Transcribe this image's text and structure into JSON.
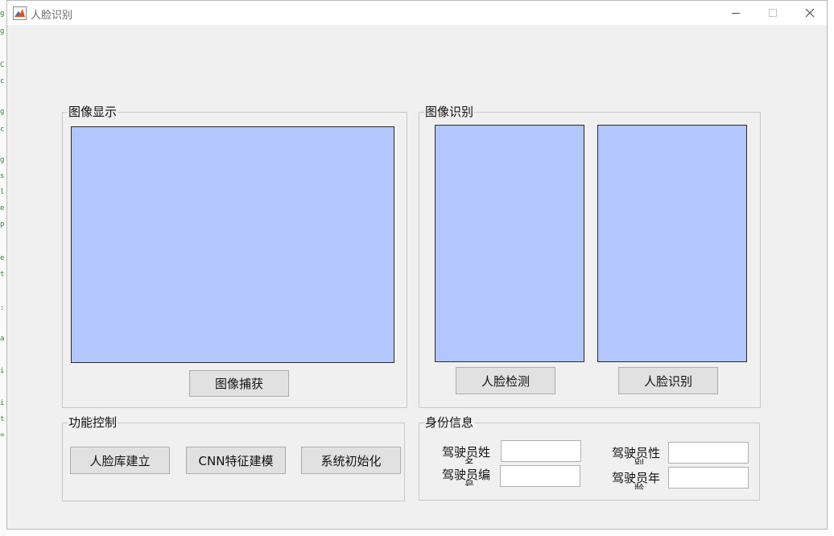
{
  "window": {
    "title": "人脸识别"
  },
  "panels": {
    "image_display": {
      "title": "图像显示",
      "capture_button": "图像捕获"
    },
    "image_recognition": {
      "title": "图像识别",
      "detect_button": "人脸检测",
      "recognize_button": "人脸识别"
    },
    "function_control": {
      "title": "功能控制",
      "buttons": [
        "人脸库建立",
        "CNN特征建模",
        "系统初始化"
      ]
    },
    "identity_info": {
      "title": "身份信息",
      "fields": [
        {
          "label": "驾驶员姓",
          "wrap": "名",
          "value": ""
        },
        {
          "label": "驾驶员编",
          "wrap": "号",
          "value": ""
        },
        {
          "label": "驾驶员性",
          "wrap": "别",
          "value": ""
        },
        {
          "label": "驾驶员年",
          "wrap": "龄",
          "value": ""
        }
      ]
    }
  },
  "colors": {
    "axes_fill": "#b3c6fe",
    "window_bg": "#f0f0f0"
  },
  "icons": {
    "app": "matlab-icon",
    "minimize": "minimize-icon",
    "maximize": "maximize-icon",
    "close": "close-icon"
  }
}
